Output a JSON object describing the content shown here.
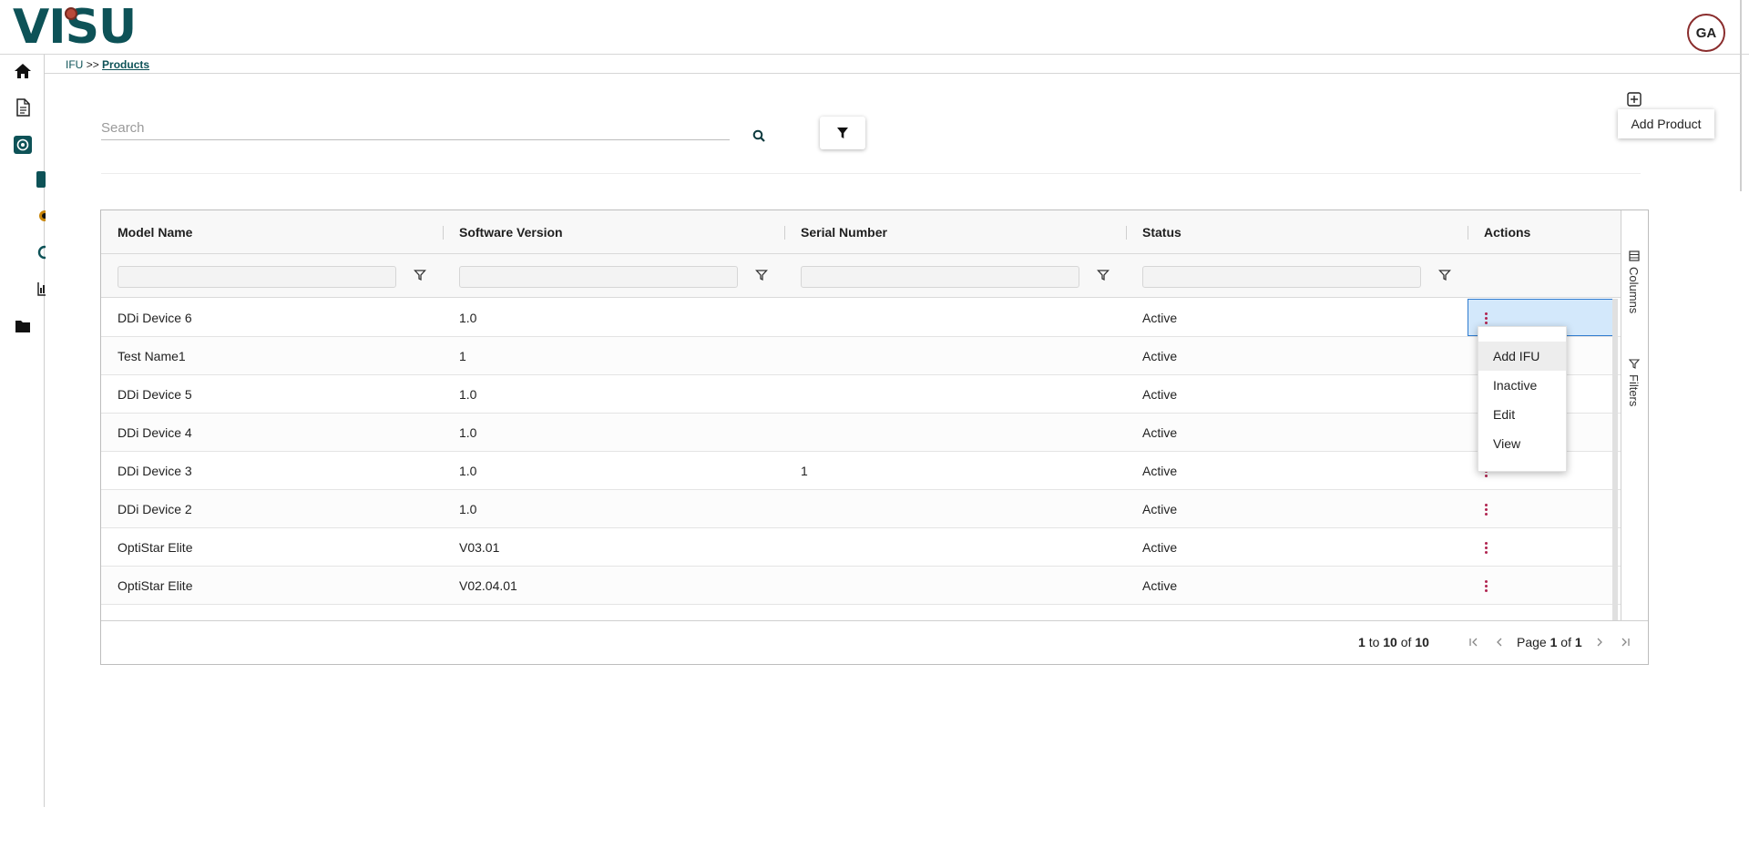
{
  "app": {
    "logo_text": "VISU",
    "avatar_initials": "GA"
  },
  "sidebar": {
    "items": [
      {
        "icon": "home-icon"
      },
      {
        "icon": "document-icon"
      },
      {
        "icon": "products-icon"
      },
      {
        "icon": "folder-icon"
      }
    ]
  },
  "breadcrumb": {
    "first": "IFU",
    "separator": ">>",
    "current": "Products"
  },
  "search": {
    "placeholder": "Search",
    "value": ""
  },
  "toolbar": {
    "add_product_label": "Add Product"
  },
  "grid": {
    "columns": [
      "Model Name",
      "Software Version",
      "Serial Number",
      "Status",
      "Actions"
    ],
    "rows": [
      {
        "model": "DDi Device 6",
        "version": "1.0",
        "serial": "",
        "status": "Active"
      },
      {
        "model": "Test Name1",
        "version": "1",
        "serial": "",
        "status": "Active"
      },
      {
        "model": "DDi Device 5",
        "version": "1.0",
        "serial": "",
        "status": "Active"
      },
      {
        "model": "DDi Device 4",
        "version": "1.0",
        "serial": "",
        "status": "Active"
      },
      {
        "model": "DDi Device 3",
        "version": "1.0",
        "serial": "1",
        "status": "Active"
      },
      {
        "model": "DDi Device 2",
        "version": "1.0",
        "serial": "",
        "status": "Active"
      },
      {
        "model": "OptiStar Elite",
        "version": "V03.01",
        "serial": "",
        "status": "Active"
      },
      {
        "model": "OptiStar Elite",
        "version": "V02.04.01",
        "serial": "",
        "status": "Active"
      }
    ],
    "side_tabs": {
      "columns": "Columns",
      "filters": "Filters"
    },
    "footer": {
      "from": "1",
      "to_word": "to",
      "to": "10",
      "of_word": "of",
      "total": "10",
      "page_word": "Page",
      "page": "1",
      "pages": "1"
    }
  },
  "action_menu": {
    "items": [
      "Add IFU",
      "Inactive",
      "Edit",
      "View"
    ]
  },
  "colors": {
    "brand": "#0d5257",
    "accent": "#b02450",
    "focus": "#d3e8fb"
  }
}
